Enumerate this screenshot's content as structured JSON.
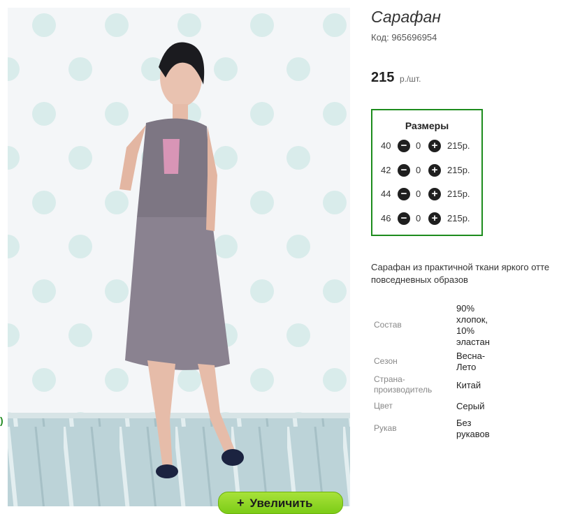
{
  "product": {
    "title": "Сарафан",
    "code": "Код: 965696954",
    "price": "215",
    "price_unit": "р./шт."
  },
  "sizes": {
    "title": "Размеры",
    "rows": [
      {
        "size": "40",
        "qty": "0",
        "price": "215р."
      },
      {
        "size": "42",
        "qty": "0",
        "price": "215р."
      },
      {
        "size": "44",
        "qty": "0",
        "price": "215р."
      },
      {
        "size": "46",
        "qty": "0",
        "price": "215р."
      }
    ]
  },
  "description": {
    "line1": "Сарафан из практичной ткани яркого отте",
    "line2": "повседневных образов"
  },
  "attributes": {
    "composition": {
      "label": "Состав",
      "v1": "90%",
      "v2": "хлопок,",
      "v3": "10%",
      "v4": "эластан"
    },
    "season": {
      "label": "Сезон",
      "v1": "Весна-",
      "v2": "Лето"
    },
    "country": {
      "label1": "Страна-",
      "label2": "производитель",
      "value": "Китай"
    },
    "color": {
      "label": "Цвет",
      "value": "Серый"
    },
    "sleeve": {
      "label": "Рукав",
      "v1": "Без",
      "v2": "рукавов"
    }
  },
  "zoom": {
    "label": "Увеличить",
    "icon": "plus-icon"
  },
  "side_fragment": ")",
  "colors": {
    "accent_green": "#1d8c1d",
    "button_green": "#8fd42a"
  }
}
